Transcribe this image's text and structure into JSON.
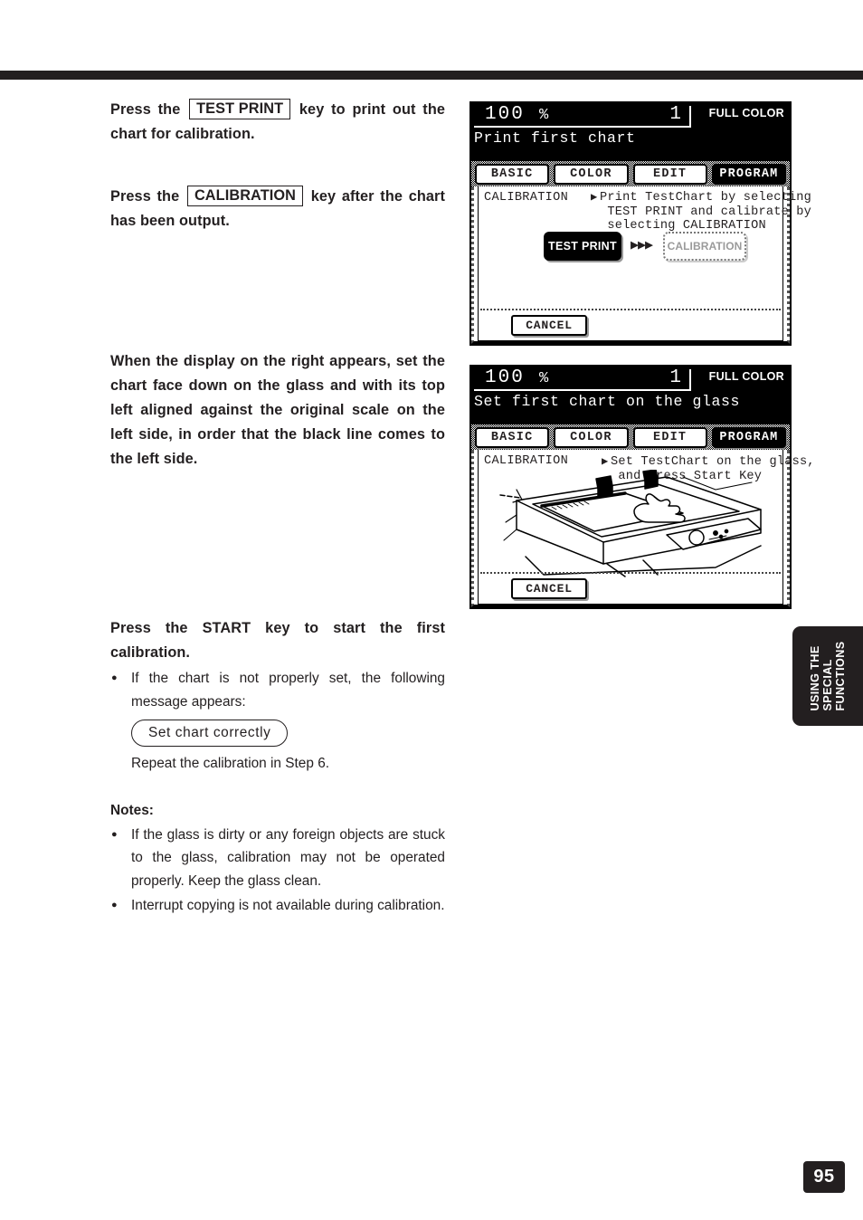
{
  "page": {
    "number": "95",
    "side_tab_line1": "USING THE",
    "side_tab_line2": "SPECIAL",
    "side_tab_line3": "FUNCTIONS"
  },
  "steps": {
    "step1_pre": "Press the",
    "step1_key": "TEST PRINT",
    "step1_post": "key to print out the chart for calibration.",
    "step2_pre": "Press the",
    "step2_key": "CALIBRATION",
    "step2_post": "key after the chart has been output.",
    "step3_text": "When the display on the right appears, set the chart face down on the glass and with its top left aligned against the original scale on the left side, in order that the black line comes to the left side.",
    "step4_text": "Press the START key to start the first calibration.",
    "step4_bullet": "If the chart is not properly set, the following message appears:",
    "step4_message_box": "Set chart correctly",
    "step4_followup": "Repeat the calibration in Step 6."
  },
  "notes": {
    "title": "Notes:",
    "items": [
      "If the glass is dirty or any foreign objects are stuck to the glass, calibration may not be operated properly. Keep the glass clean.",
      "Interrupt copying is not available during calibration."
    ]
  },
  "panel1": {
    "ratio": "100",
    "percent": "%",
    "copies": "1",
    "color_mode": "FULL COLOR",
    "message": "Print first chart",
    "tabs": [
      {
        "label": "BASIC",
        "selected": false
      },
      {
        "label": "COLOR",
        "selected": false
      },
      {
        "label": "EDIT",
        "selected": false
      },
      {
        "label": "PROGRAM",
        "selected": true
      }
    ],
    "function_label": "CALIBRATION",
    "arrow": "▶",
    "instruction": "Print TestChart by selecting\n TEST PRINT and calibrate by\n selecting CALIBRATION",
    "test_print_label": "TEST PRINT",
    "arrows": "▶▶▶",
    "calibration_label": "CALIBRATION",
    "cancel_label": "CANCEL"
  },
  "panel2": {
    "ratio": "100",
    "percent": "%",
    "copies": "1",
    "color_mode": "FULL COLOR",
    "message": "Set first chart on the glass",
    "tabs": [
      {
        "label": "BASIC",
        "selected": false
      },
      {
        "label": "COLOR",
        "selected": false
      },
      {
        "label": "EDIT",
        "selected": false
      },
      {
        "label": "PROGRAM",
        "selected": true
      }
    ],
    "function_label": "CALIBRATION",
    "arrow": "▶",
    "instruction": "Set TestChart on the glass,\n and Press Start Key",
    "cancel_label": "CANCEL"
  },
  "colors": {
    "ink": "#231f20",
    "lcd_header_bg": "#000000",
    "lcd_bg": "#ffffff"
  }
}
